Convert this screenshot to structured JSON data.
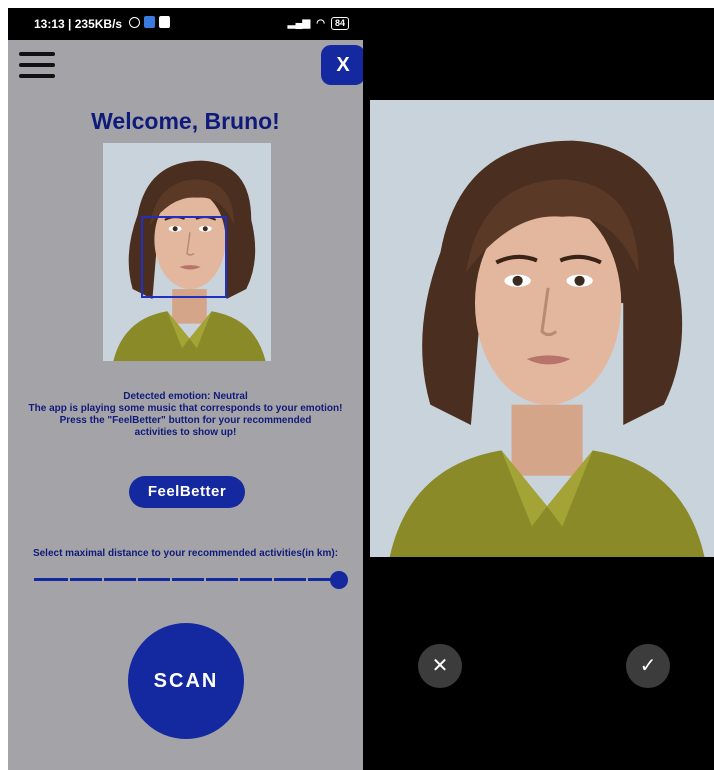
{
  "status_bar": {
    "time_speed": "13:13 | 235KB/s",
    "battery": "84"
  },
  "app": {
    "close_label": "X",
    "welcome": "Welcome, Bruno!",
    "info_lines": [
      "Detected emotion: Neutral",
      "The app is playing some music that corresponds to your emotion!",
      "Press the \"FeelBetter\" button for your recommended",
      "activities to show up!"
    ],
    "feelbetter_label": "FeelBetter",
    "distance_label": "Select maximal distance to your recommended activities(in km):",
    "slider_value": 1.0,
    "scan_label": "SCAN"
  },
  "camera": {
    "cancel_icon": "close-icon",
    "confirm_icon": "check-icon"
  },
  "colors": {
    "accent": "#1428a0",
    "text_dark_blue": "#101a7a",
    "screen_bg": "#a4a4a8"
  }
}
